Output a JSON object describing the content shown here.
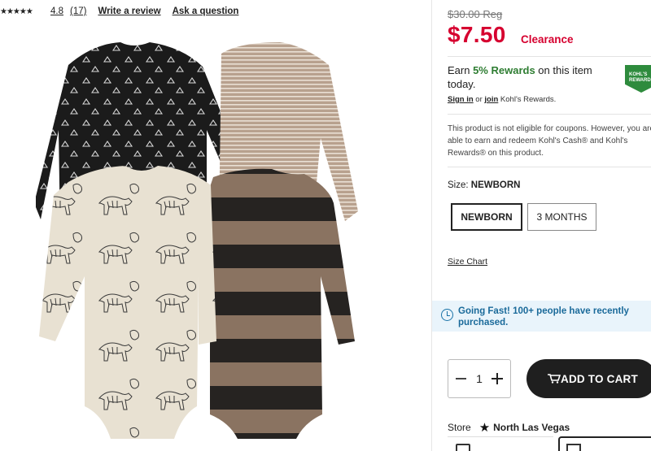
{
  "reviews": {
    "stars_glyph": "★★★★★",
    "rating": "4.8",
    "count": "(17)",
    "write_label": "Write a review",
    "ask_label": "Ask a question"
  },
  "price": {
    "original": "$30.00 Reg",
    "current": "$7.50",
    "tag": "Clearance"
  },
  "rewards": {
    "prefix": "Earn ",
    "highlight": "5% Rewards",
    "suffix": " on this item today.",
    "badge": "KOHL'S REWARDS",
    "signin": "Sign in",
    "or": " or ",
    "join": "join",
    "tail": " Kohl's Rewards."
  },
  "coupon_note": "This product is not eligible for coupons. However, you are able to earn and redeem Kohl's Cash® and Kohl's Rewards® on this product.",
  "size": {
    "label": "Size:",
    "selected": "NEWBORN",
    "options": [
      "NEWBORN",
      "3 MONTHS"
    ],
    "chart_label": "Size Chart"
  },
  "alert": {
    "text": "Going Fast! 100+ people have recently purchased."
  },
  "quantity": {
    "value": "1"
  },
  "cart": {
    "label": "ADD TO CART"
  },
  "store": {
    "label": "Store",
    "name": "North Las Vegas"
  },
  "colors": {
    "price_red": "#d6002f",
    "rewards_green": "#2e7d32",
    "alert_blue": "#1a6a9a",
    "button_dark": "#1f1f1f"
  },
  "icons": [
    "star-icon",
    "clock-icon",
    "minus-icon",
    "plus-icon",
    "cart-icon",
    "store-star-icon"
  ]
}
